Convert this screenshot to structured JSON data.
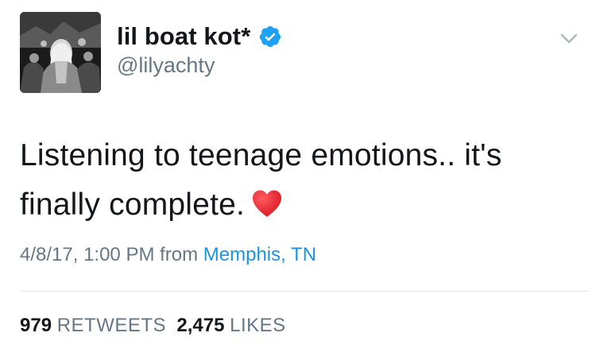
{
  "tweet": {
    "author": {
      "display_name": "lil boat kot*",
      "handle": "@lilyachty",
      "verified": true
    },
    "text_line1": "Listening to teenage emotions.. it's",
    "text_line2": "finally complete.",
    "emoji": "heart-emoji",
    "timestamp": "4/8/17, 1:00 PM from",
    "location": "Memphis, TN",
    "retweets_count": "979",
    "retweets_label": "RETWEETS",
    "likes_count": "2,475",
    "likes_label": "LIKES"
  },
  "colors": {
    "link_blue": "#1b95e0",
    "verified_blue": "#1da1f2",
    "muted_gray": "#657786",
    "text_dark": "#14171a",
    "heart_red": "#e0202a"
  },
  "icons": {
    "verified": "verified-badge-icon",
    "menu": "chevron-down-icon",
    "emoji": "red-heart-emoji"
  }
}
